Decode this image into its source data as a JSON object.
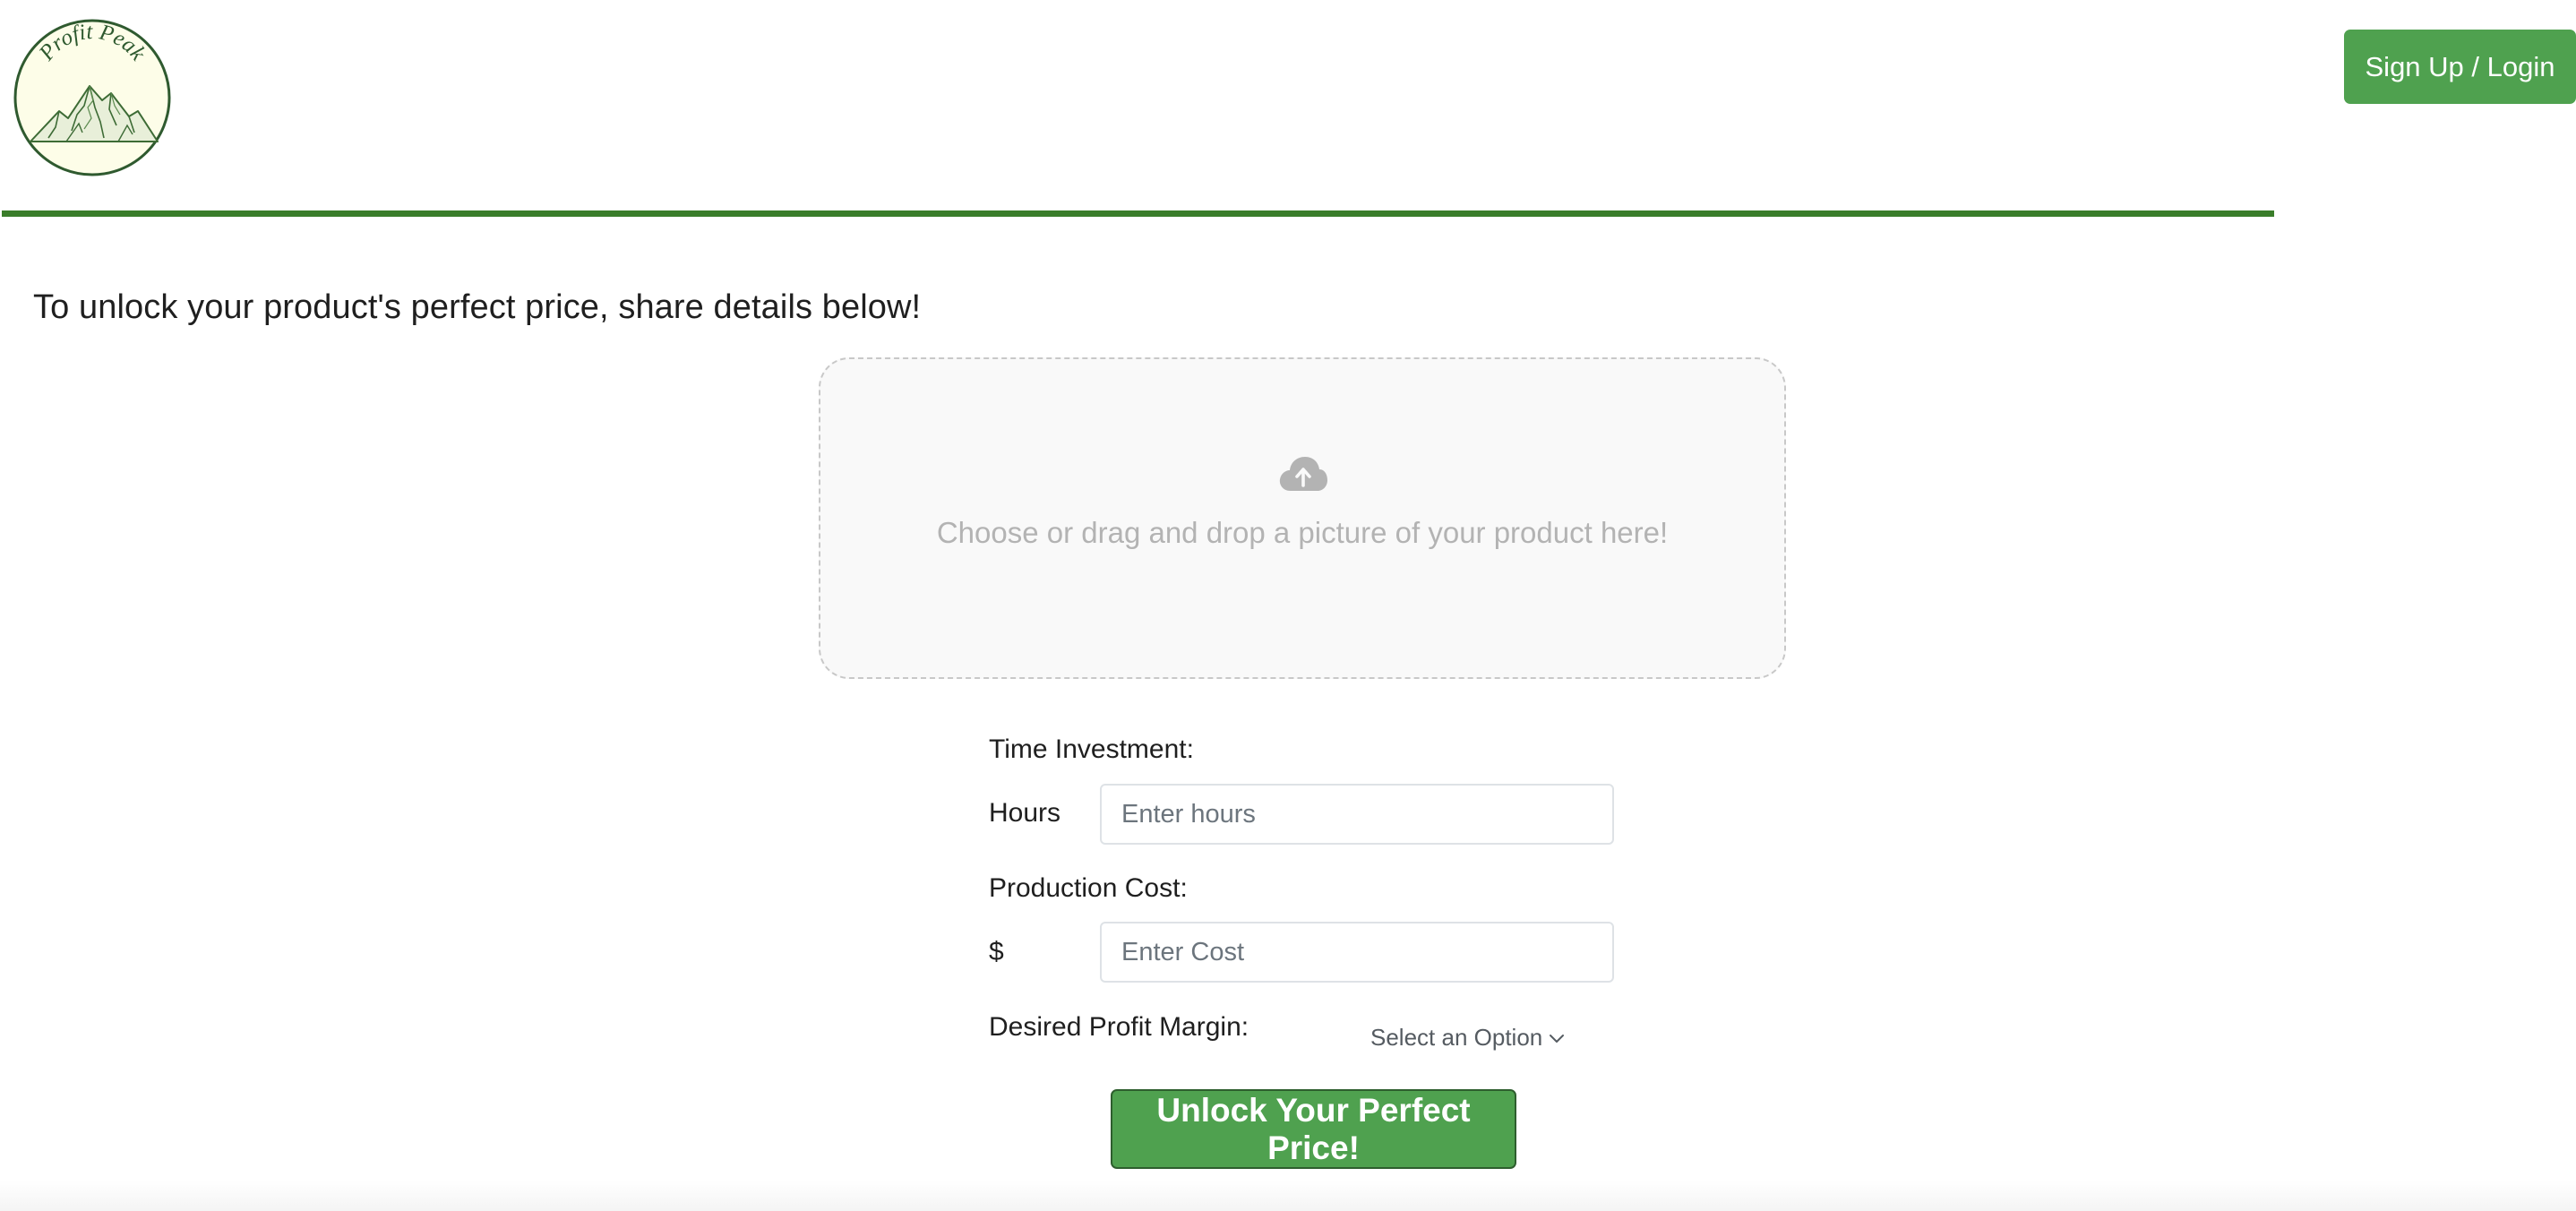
{
  "header": {
    "logo_text": "Profit Peak",
    "auth_button_label": "Sign Up / Login"
  },
  "intro": {
    "heading": "To unlock your product's perfect price, share details below!"
  },
  "dropzone": {
    "icon": "cloud-upload-icon",
    "text": "Choose or drag and drop a picture of your product here!"
  },
  "form": {
    "time_investment_label": "Time Investment:",
    "hours_unit": "Hours",
    "hours_placeholder": "Enter hours",
    "production_cost_label": "Production Cost:",
    "currency_unit": "$",
    "cost_placeholder": "Enter Cost",
    "profit_margin_label": "Desired Profit Margin:",
    "profit_margin_selected": "Select an Option",
    "submit_label": "Unlock Your Perfect Price!"
  },
  "colors": {
    "brand_green": "#4fa14f",
    "header_rule": "#3a7d2a",
    "logo_bg": "#fdfde8",
    "logo_border": "#2f5a2f"
  }
}
